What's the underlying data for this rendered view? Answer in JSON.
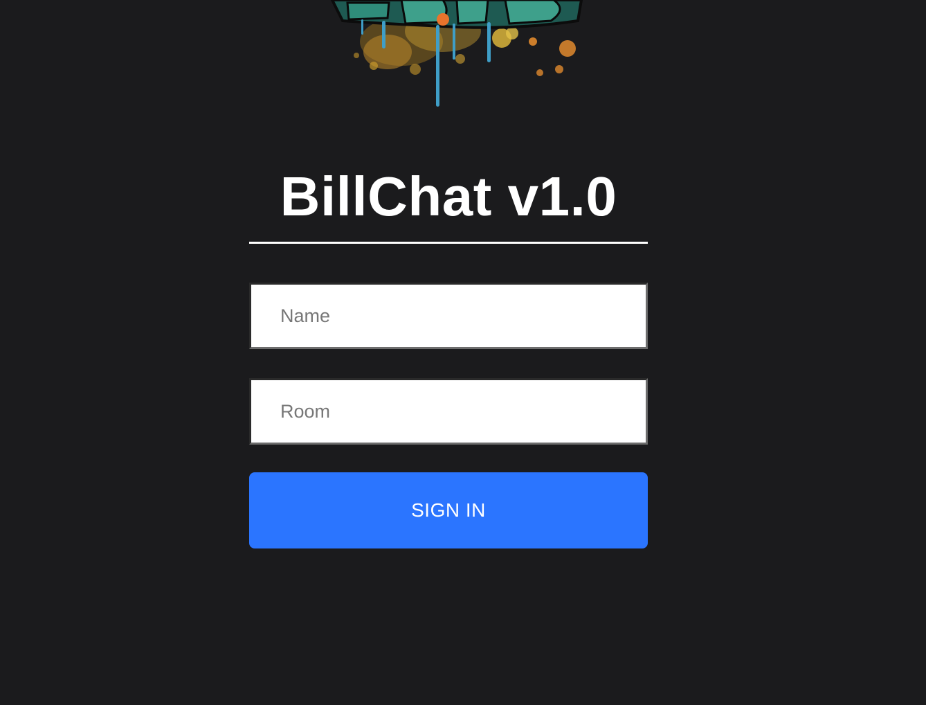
{
  "app": {
    "title": "BillChat v1.0"
  },
  "form": {
    "name_placeholder": "Name",
    "name_value": "",
    "room_placeholder": "Room",
    "room_value": "",
    "sign_in_label": "SIGN IN"
  },
  "colors": {
    "background": "#1b1b1d",
    "button": "#2b75ff",
    "title": "#ffffff"
  },
  "logo": {
    "icon": "graffiti-logo-icon"
  }
}
